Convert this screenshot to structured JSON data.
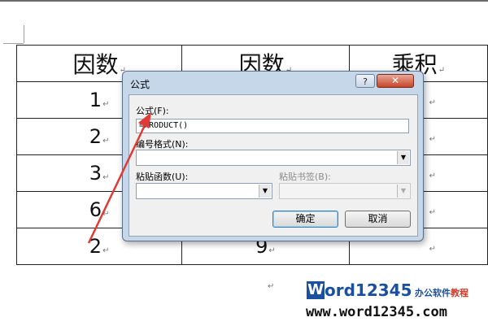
{
  "table": {
    "headers": [
      "因数",
      "因数",
      "乘积"
    ],
    "rows": [
      [
        "1",
        "",
        ""
      ],
      [
        "2",
        "",
        ""
      ],
      [
        "3",
        "",
        ""
      ],
      [
        "6",
        "",
        ""
      ],
      [
        "2",
        "9",
        ""
      ]
    ],
    "paragraph_mark": "↵"
  },
  "dialog": {
    "title": "公式",
    "help_label": "?",
    "close_label": "✕",
    "formula_label": "公式(F):",
    "formula_value": "=PRODUCT()",
    "number_format_label": "编号格式(N):",
    "number_format_value": "",
    "paste_function_label": "粘贴函数(U):",
    "paste_function_value": "",
    "paste_bookmark_label": "粘贴书签(B):",
    "paste_bookmark_value": "",
    "ok_label": "确定",
    "cancel_label": "取消",
    "dropdown_glyph": "▼"
  },
  "watermark": {
    "logo_letter": "W",
    "logo_rest": "ord12345",
    "tag_prefix": "办公软件",
    "tag_suffix": "教程",
    "url": "www.word12345.com"
  },
  "colors": {
    "dialog_frame": "#c7d7ea",
    "annotation_arrow": "#e03a36",
    "watermark_blue": "#1b4fa0"
  }
}
